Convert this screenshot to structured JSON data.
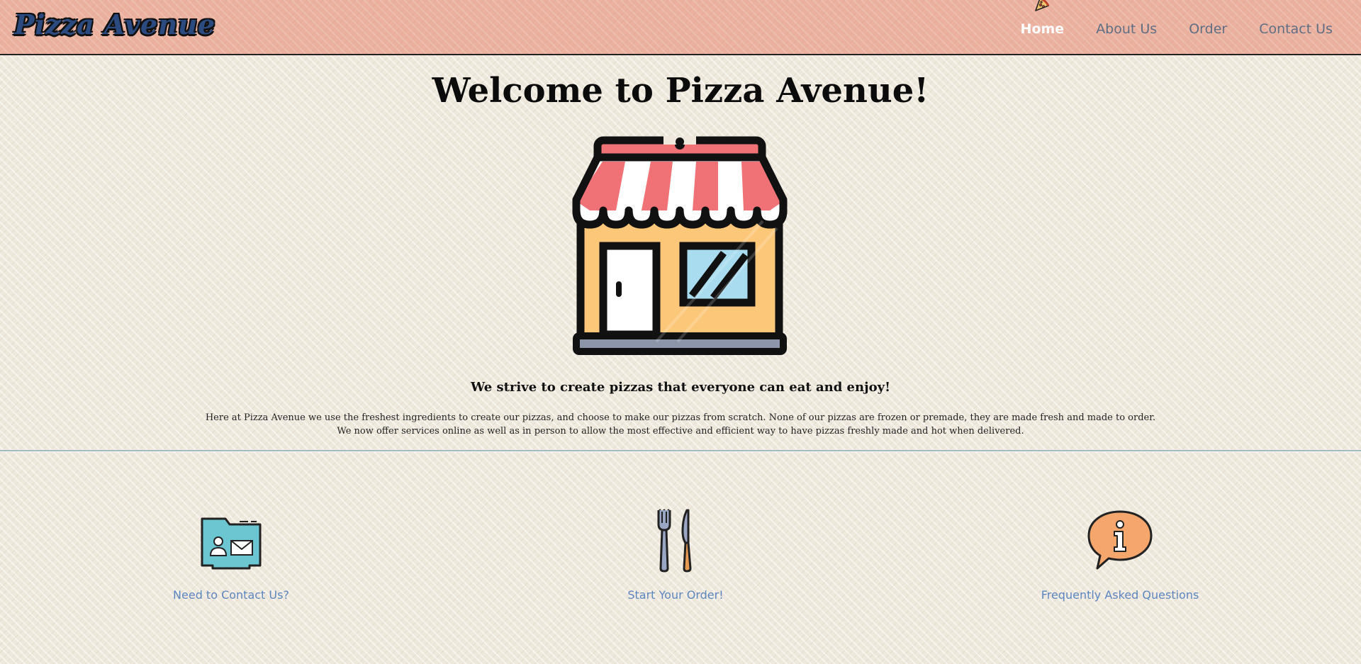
{
  "brand": {
    "name": "Pizza Avenue"
  },
  "nav": {
    "items": [
      {
        "label": "Home",
        "active": true
      },
      {
        "label": "About Us",
        "active": false
      },
      {
        "label": "Order",
        "active": false
      },
      {
        "label": "Contact Us",
        "active": false
      }
    ],
    "active_icon": "pizza-slice-icon"
  },
  "hero": {
    "title": "Welcome to Pizza Avenue!",
    "image_icon": "storefront-icon",
    "tagline": "We strive to create pizzas that everyone can eat and enjoy!",
    "description_lines": [
      "Here at Pizza Avenue we use the freshest ingredients to create our pizzas, and choose to make our pizzas from scratch. None of our pizzas are frozen or premade, they are made fresh and made to order.",
      "We now offer services online as well as in person to allow the most effective and efficient way to have pizzas freshly made and hot when delivered."
    ]
  },
  "features": [
    {
      "label": "Need to Contact Us?",
      "icon": "contact-folder-icon"
    },
    {
      "label": "Start Your Order!",
      "icon": "fork-knife-icon"
    },
    {
      "label": "Frequently Asked Questions",
      "icon": "info-speech-bubble-icon"
    }
  ],
  "colors": {
    "nav_background": "#ebb19e",
    "page_background": "#efe8dc",
    "brand_text": "#2b4a80",
    "nav_link": "#5d6e85",
    "nav_active": "#ffffff",
    "feature_link": "#5b86c0",
    "divider": "#9fbac0"
  }
}
